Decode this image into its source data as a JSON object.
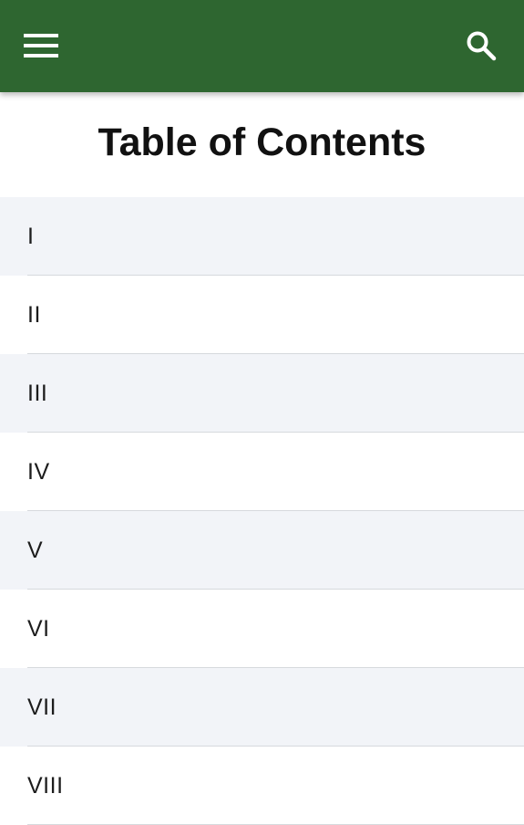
{
  "app_bar": {
    "menu_icon": "hamburger-menu-icon",
    "search_icon": "search-icon",
    "background_color": "#2e6630"
  },
  "page": {
    "title": "Table of Contents"
  },
  "toc": {
    "items": [
      {
        "label": "I"
      },
      {
        "label": "II"
      },
      {
        "label": "III"
      },
      {
        "label": "IV"
      },
      {
        "label": "V"
      },
      {
        "label": "VI"
      },
      {
        "label": "VII"
      },
      {
        "label": "VIII"
      }
    ]
  }
}
